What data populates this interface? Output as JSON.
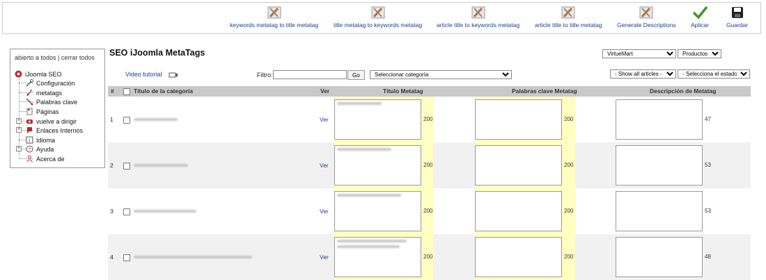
{
  "toolbar": {
    "buttons": [
      {
        "label": "keywords metatag to title metatag",
        "icon": "tools-icon"
      },
      {
        "label": "title metatag to keywords metatag",
        "icon": "tools-icon"
      },
      {
        "label": "article title to keywords metatag",
        "icon": "tools-icon"
      },
      {
        "label": "article title to title metatag",
        "icon": "tools-icon"
      },
      {
        "label": "Generate Descriptions",
        "icon": "tools-icon"
      },
      {
        "label": "Aplicar",
        "icon": "check-icon"
      },
      {
        "label": "Guardar",
        "icon": "save-icon"
      }
    ]
  },
  "sidebar": {
    "toggle_text": "abierto a todos | cerrar todos",
    "root": "iJoomla SEO",
    "items": [
      {
        "label": "Configuración",
        "icon": "wrench-icon"
      },
      {
        "label": "metatags",
        "icon": "tag-icon"
      },
      {
        "label": "Palabras clave",
        "icon": "pen-icon"
      },
      {
        "label": "Páginas",
        "icon": "page-icon"
      },
      {
        "label": "vuelve a dirigir",
        "icon": "redirect-icon"
      },
      {
        "label": "Enlaces Internos",
        "icon": "link-icon"
      },
      {
        "label": "Idioma",
        "icon": "language-icon"
      },
      {
        "label": "Ayuda",
        "icon": "help-icon"
      },
      {
        "label": "Acerca de",
        "icon": "about-icon"
      }
    ]
  },
  "main": {
    "title": "SEO iJoomla MetaTags",
    "video_tutorial": "Video tutorial",
    "filter_label": "Filtro:",
    "go_label": "Go",
    "source_select": "VirtueMart",
    "type_select": "Productos",
    "category_select": "Seleccionar categoría",
    "articles_select": "- Show all articles -",
    "state_select": "- Selecciona el estado -"
  },
  "table": {
    "headers": {
      "num": "#",
      "title": "Título de la categoría",
      "ver": "Ver",
      "title_meta": "Título Metatag",
      "keywords_meta": "Palabras clave Metatag",
      "desc_meta": "Descripción de Metatag"
    },
    "rows": [
      {
        "num": "1",
        "ver": "Ver",
        "title_count": "200",
        "keywords_count": "200",
        "desc_count": "47"
      },
      {
        "num": "2",
        "ver": "Ver",
        "title_count": "200",
        "keywords_count": "200",
        "desc_count": "53"
      },
      {
        "num": "3",
        "ver": "Ver",
        "title_count": "200",
        "keywords_count": "200",
        "desc_count": "53"
      },
      {
        "num": "4",
        "ver": "Ver",
        "title_count": "200",
        "keywords_count": "200",
        "desc_count": "48"
      }
    ]
  },
  "colors": {
    "link": "#1a3f8f",
    "header_bg": "#c9c9c9",
    "highlight": "#ffffc2"
  }
}
